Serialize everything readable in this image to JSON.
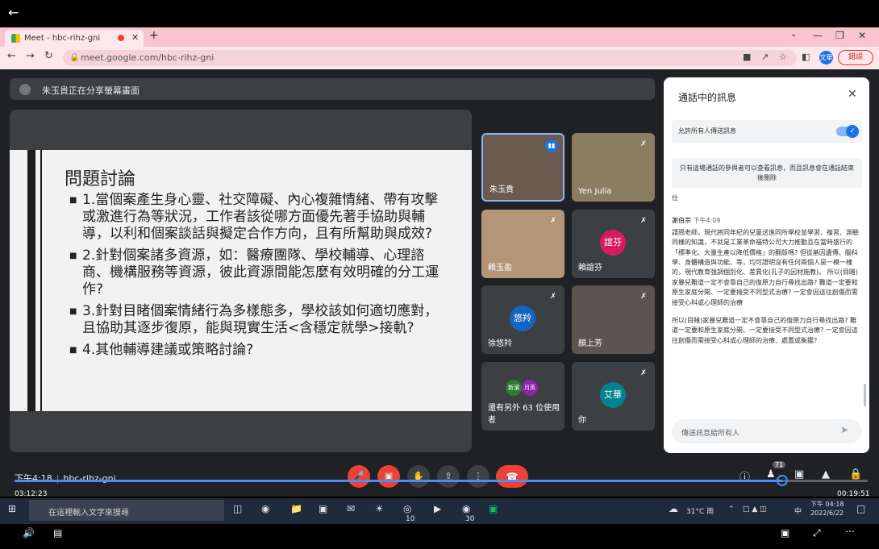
{
  "browser": {
    "tab_title": "Meet - hbc-rihz-gni",
    "url": "meet.google.com/hbc-rihz-gni",
    "profile_initials": "文華",
    "update_label": "錯誤"
  },
  "meet": {
    "presenter_notice": "朱玉貴正在分享螢幕畫面",
    "slide": {
      "title": "問題討論",
      "bullets": [
        "1.當個案產生身心靈、社交障礙、內心複雜情緒、帶有攻擊或激進行為等狀況，工作者該從哪方面優先著手協助與輔導，以利和個案談話與擬定合作方向，且有所幫助與成效?",
        "2.針對個案諸多資源，如：醫療團隊、學校輔導、心理諮商、機構服務等資源，彼此資源間能怎麼有效明確的分工運作?",
        "3.針對目睹個案情緒行為多樣態多，學校該如何適切應對，且協助其逐步復原，能與現實生活<含穩定就學>接軌?",
        "4.其他輔導建議或策略討論?"
      ]
    },
    "participants": [
      {
        "name": "朱玉貴",
        "type": "video"
      },
      {
        "name": "Yen Julia",
        "type": "video"
      },
      {
        "name": "賴玉盈",
        "type": "video"
      },
      {
        "name": "賴誼芬",
        "initials": "誼芬",
        "color": "#d81b60"
      },
      {
        "name": "徐悠羚",
        "initials": "悠羚",
        "color": "#1565c0"
      },
      {
        "name": "顏上芳",
        "type": "video"
      },
      {
        "name": "還有另外 63 位使用者",
        "chips": [
          "新濱",
          "月英"
        ]
      },
      {
        "name": "你",
        "initials": "艾華",
        "color": "#00838f"
      }
    ],
    "meeting_time": "下午4:18",
    "meeting_code": "hbc-rihz-gni",
    "people_count": "71"
  },
  "chat": {
    "title": "通話中的訊息",
    "allow_label": "允許所有人傳送訊息",
    "notice": "只有這場通話的參與者可以查看訊息，而且訊息會在通話結束後刪除",
    "partial": "仕",
    "messages": [
      {
        "sender": "謝伯宗",
        "time": "下午4:09",
        "text": "請問老師，現代將同年紀的兒童送進同所學校並學習、複習、測驗同樣的知識，不就是工業革命福特公司大力推動且在當時盛行的「標準化、大量生產以降低價格」的翻版嗎? 但從基因遺傳、腦科學、身體構造與功能、等，均可證明沒有任何兩個人是一模一樣的，現代教育強調個別化、差異化(孔子的因材施教)。         所以(目睹)家暴兒難道一定不會靠自己的復原力自行尋找出路? 難道一定要和原生家庭分開、一定要接受不同型式治療? 一定會因這往創傷而需接受心科或心理師的治療"
      },
      {
        "sender": "",
        "time": "",
        "text": " 所以(目睹)家暴兒難道一定不會靠自己的復原力自行尋找出路? 難道一定要和原生家庭分開、一定要接受不同型式治療? 一定會因這往創傷而需接受心科或心理師的治療、處置或衡鑑?"
      }
    ],
    "input_placeholder": "傳送訊息給所有人"
  },
  "player": {
    "elapsed": "03:12:23",
    "remaining": "00:19:51",
    "progress_fraction": 0.9
  },
  "taskbar": {
    "search_placeholder": "在這裡輸入文字來搜尋",
    "weather": "31°C 雨",
    "ime": "中",
    "clock_time": "下午 04:18",
    "clock_date": "2022/6/22",
    "badge_a": "10",
    "badge_b": "30"
  }
}
